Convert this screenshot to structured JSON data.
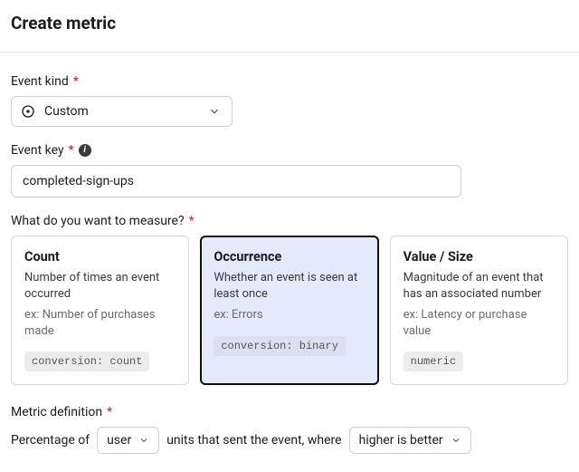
{
  "title": "Create metric",
  "field_labels": {
    "event_kind": "Event kind",
    "event_key": "Event key",
    "measure_question": "What do you want to measure?",
    "metric_definition": "Metric definition"
  },
  "required_mark": "*",
  "event_kind": {
    "selected": "Custom"
  },
  "event_key": {
    "value": "completed-sign-ups"
  },
  "measure_options": [
    {
      "key": "count",
      "title": "Count",
      "desc": "Number of times an event occurred",
      "example": "ex: Number of purchases made",
      "tag": "conversion: count",
      "selected": false
    },
    {
      "key": "occurrence",
      "title": "Occurrence",
      "desc": "Whether an event is seen at least once",
      "example": "ex: Errors",
      "tag": "conversion: binary",
      "selected": true
    },
    {
      "key": "value",
      "title": "Value / Size",
      "desc": "Magnitude of an event that has an associated number",
      "example": "ex: Latency or purchase value",
      "tag": "numeric",
      "selected": false
    }
  ],
  "definition_sentence": {
    "prefix": "Percentage of",
    "unit": "user",
    "middle": "units that sent the event, where",
    "direction": "higher is better"
  }
}
